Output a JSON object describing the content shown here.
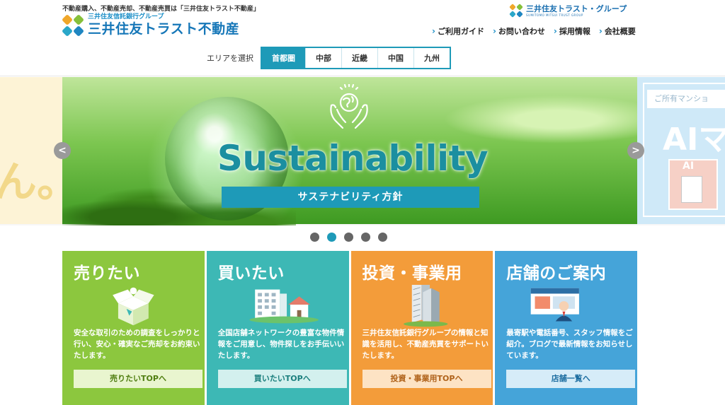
{
  "header": {
    "tagline": "不動産購入、不動産売却、不動産売買は「三井住友トラスト不動産」",
    "logo_sub": "三井住友信託銀行グループ",
    "logo_main": "三井住友トラスト不動産",
    "group_logo_main": "三井住友トラスト・グループ",
    "group_logo_en": "SUMITOMO MITSUI TRUST GROUP",
    "utility_links": [
      "ご利用ガイド",
      "お問い合わせ",
      "採用情報",
      "会社概要"
    ]
  },
  "area_select": {
    "label": "エリアを選択",
    "tabs": [
      "首都圏",
      "中部",
      "近畿",
      "中国",
      "九州"
    ],
    "active": "首都圏"
  },
  "carousel": {
    "prev_arrow": "<",
    "next_arrow": ">",
    "main_title": "Sustainability",
    "main_subtitle": "サステナビリティ方針",
    "prev_slide_deco": "ん。",
    "next_slide_caption": "ご所有マンショ",
    "next_slide_big": "AIマ",
    "next_slide_small": "AI",
    "dot_count": 5,
    "active_dot": 2
  },
  "cards": [
    {
      "title": "売りたい",
      "desc": "安全な取引のための調査をしっかりと行い、安心・確実なご売却をお約束いたします。",
      "button": "売りたいTOPへ",
      "color": "#8cc73e"
    },
    {
      "title": "買いたい",
      "desc": "全国店舗ネットワークの豊富な物件情報をご用意し、物件探しをお手伝いいたします。",
      "button": "買いたいTOPへ",
      "color": "#3db8b5"
    },
    {
      "title": "投資・事業用",
      "desc": "三井住友信託銀行グループの情報と知識を活用し、不動産売買をサポートいたします。",
      "button": "投資・事業用TOPへ",
      "color": "#f39c3a"
    },
    {
      "title": "店舗のご案内",
      "desc": "最寄駅や電話番号、スタッフ情報をご紹介。ブログで最新情報をお知らせしています。",
      "button": "店舗一覧へ",
      "color": "#45a4d9"
    }
  ],
  "colors": {
    "accent": "#1e9ab8",
    "brand_blue": "#1677b8"
  }
}
